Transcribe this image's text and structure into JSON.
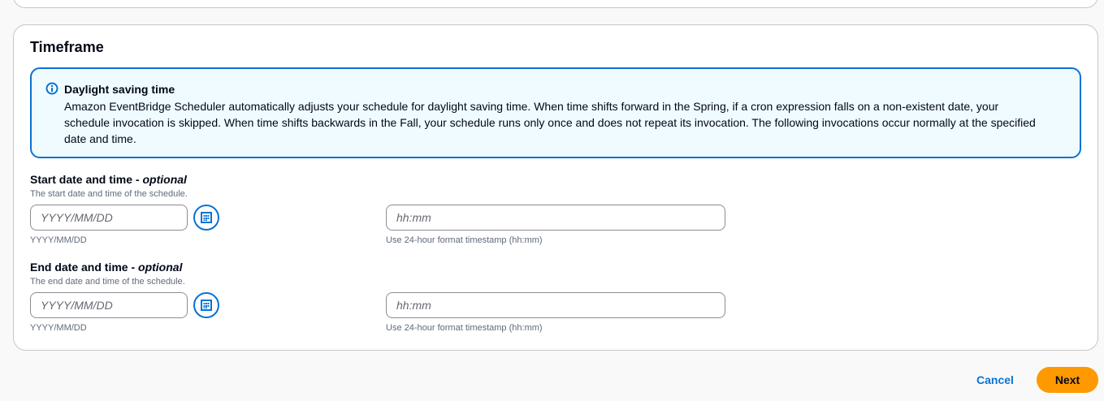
{
  "timeframe": {
    "title": "Timeframe",
    "alert": {
      "icon": "info-circle-icon",
      "title": "Daylight saving time",
      "body": "Amazon EventBridge Scheduler automatically adjusts your schedule for daylight saving time. When time shifts forward in the Spring, if a cron expression falls on a non-existent date, your schedule invocation is skipped. When time shifts backwards in the Fall, your schedule runs only once and does not repeat its invocation. The following invocations occur normally at the specified date and time."
    },
    "start": {
      "label": "Start date and time",
      "label_suffix": " - ",
      "optional": "optional",
      "description": "The start date and time of the schedule.",
      "date_placeholder": "YYYY/MM/DD",
      "date_value": "",
      "date_hint": "YYYY/MM/DD",
      "time_placeholder": "hh:mm",
      "time_value": "",
      "time_hint": "Use 24-hour format timestamp (hh:mm)"
    },
    "end": {
      "label": "End date and time",
      "label_suffix": " - ",
      "optional": "optional",
      "description": "The end date and time of the schedule.",
      "date_placeholder": "YYYY/MM/DD",
      "date_value": "",
      "date_hint": "YYYY/MM/DD",
      "time_placeholder": "hh:mm",
      "time_value": "",
      "time_hint": "Use 24-hour format timestamp (hh:mm)"
    }
  },
  "actions": {
    "cancel_label": "Cancel",
    "next_label": "Next"
  },
  "colors": {
    "accent": "#0972d3",
    "primary_button": "#ff9900",
    "alert_background": "#f0fbff"
  }
}
